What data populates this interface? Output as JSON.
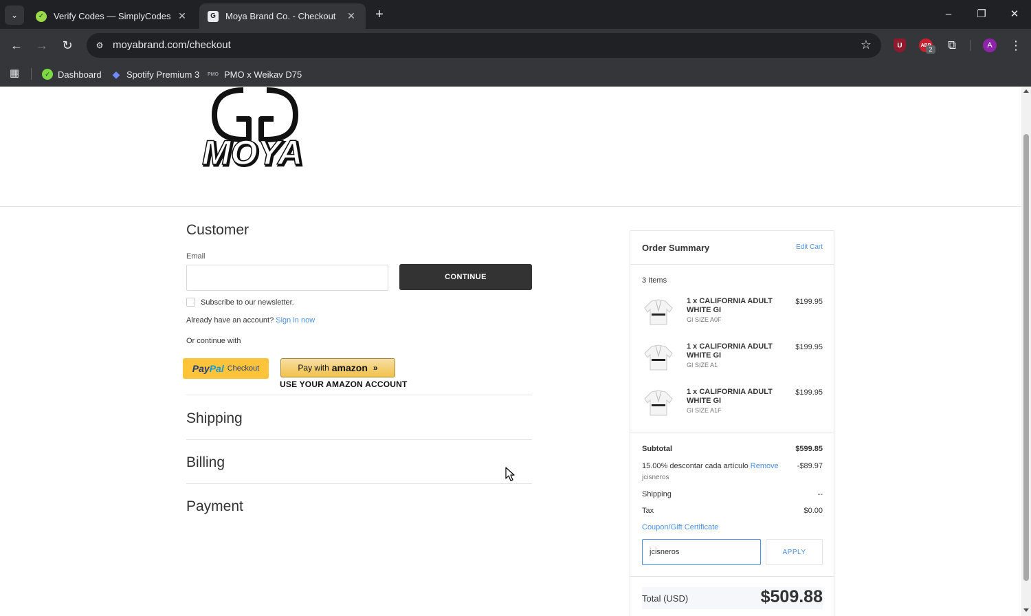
{
  "browser": {
    "tabs": [
      {
        "title": "Verify Codes — SimplyCodes",
        "active": false
      },
      {
        "title": "Moya Brand Co. - Checkout",
        "active": true
      }
    ],
    "url": "moyabrand.com/checkout",
    "profile_initial": "A",
    "ext_badge": "2",
    "bookmarks": [
      "Dashboard",
      "Spotify Premium 3",
      "PMO x Weikav D75"
    ]
  },
  "page": {
    "brand_logo_text": "MOYA",
    "customer": {
      "title": "Customer",
      "email_label": "Email",
      "email_value": "",
      "continue_label": "CONTINUE",
      "newsletter_label": "Subscribe to our newsletter.",
      "already_account": "Already have an account?",
      "sign_in_label": "Sign in now",
      "or_continue": "Or continue with",
      "paypal_brand_pay": "Pay",
      "paypal_brand_pal": "Pal",
      "paypal_suffix": "Checkout",
      "amazon_pay_with": "Pay with",
      "amazon_brand": "amazon",
      "amazon_sub": "USE YOUR AMAZON ACCOUNT"
    },
    "steps": [
      "Shipping",
      "Billing",
      "Payment"
    ]
  },
  "summary": {
    "title": "Order Summary",
    "edit_cart": "Edit Cart",
    "items_count": "3 Items",
    "items": [
      {
        "name": "1 x CALIFORNIA ADULT WHITE GI",
        "size": "GI SIZE A0F",
        "price": "$199.95"
      },
      {
        "name": "1 x CALIFORNIA ADULT WHITE GI",
        "size": "GI SIZE A1",
        "price": "$199.95"
      },
      {
        "name": "1 x CALIFORNIA ADULT WHITE GI",
        "size": "GI SIZE A1F",
        "price": "$199.95"
      }
    ],
    "subtotal_label": "Subtotal",
    "subtotal_value": "$599.85",
    "discount_label": "15.00% descontar cada artículo",
    "discount_remove": "Remove",
    "discount_value": "-$89.97",
    "discount_code": "jcisneros",
    "shipping_label": "Shipping",
    "shipping_value": "--",
    "tax_label": "Tax",
    "tax_value": "$0.00",
    "coupon_link": "Coupon/Gift Certificate",
    "coupon_input_value": "jcisneros",
    "apply_label": "APPLY",
    "total_label": "Total (USD)",
    "total_value": "$509.88"
  }
}
